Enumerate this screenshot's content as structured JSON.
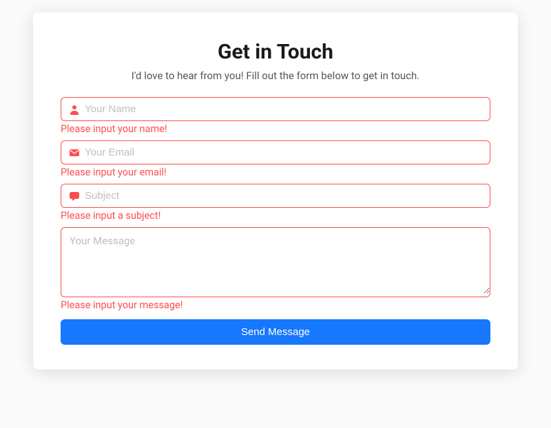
{
  "header": {
    "title": "Get in Touch",
    "subtitle": "I'd love to hear from you! Fill out the form below to get in touch."
  },
  "form": {
    "name": {
      "placeholder": "Your Name",
      "value": "",
      "error": "Please input your name!"
    },
    "email": {
      "placeholder": "Your Email",
      "value": "",
      "error": "Please input your email!"
    },
    "subject": {
      "placeholder": "Subject",
      "value": "",
      "error": "Please input a subject!"
    },
    "message": {
      "placeholder": "Your Message",
      "value": "",
      "error": "Please input your message!"
    },
    "submit_label": "Send Message"
  },
  "colors": {
    "error": "#ff4d4f",
    "primary": "#1677ff"
  }
}
